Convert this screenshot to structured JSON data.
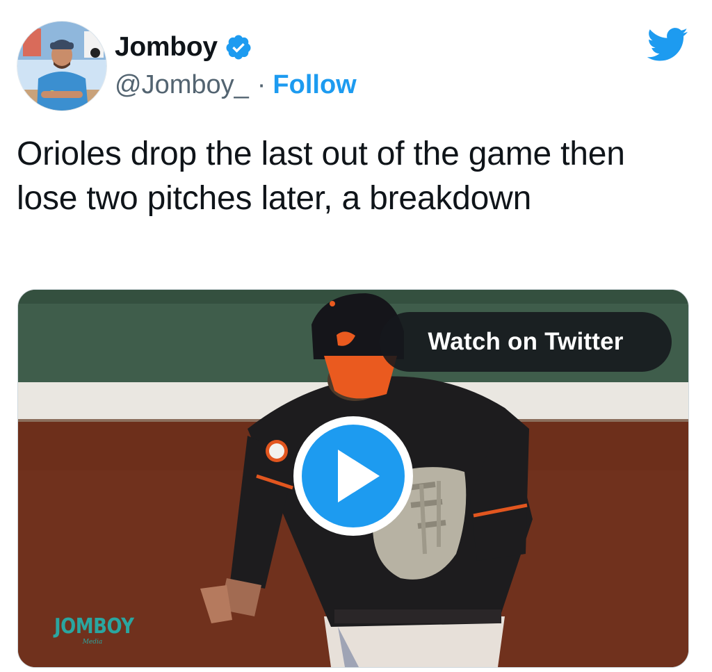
{
  "tweet": {
    "author": {
      "display_name": "Jomboy",
      "verified": true,
      "handle": "@Jomboy_",
      "separator": "·",
      "follow_label": "Follow",
      "avatar_icon": "avatar-photo"
    },
    "logo_icon": "twitter-bird-icon",
    "text": "Orioles drop the last out of the game then lose two pitches later, a breakdown",
    "media": {
      "type": "video",
      "watch_label": "Watch on Twitter",
      "play_icon": "play-icon",
      "watermark": "JOMBOY",
      "watermark_sub": "Media"
    }
  },
  "colors": {
    "accent": "#1d9bf0",
    "text": "#0f1419",
    "secondary": "#536471",
    "pill": "#16181c"
  }
}
